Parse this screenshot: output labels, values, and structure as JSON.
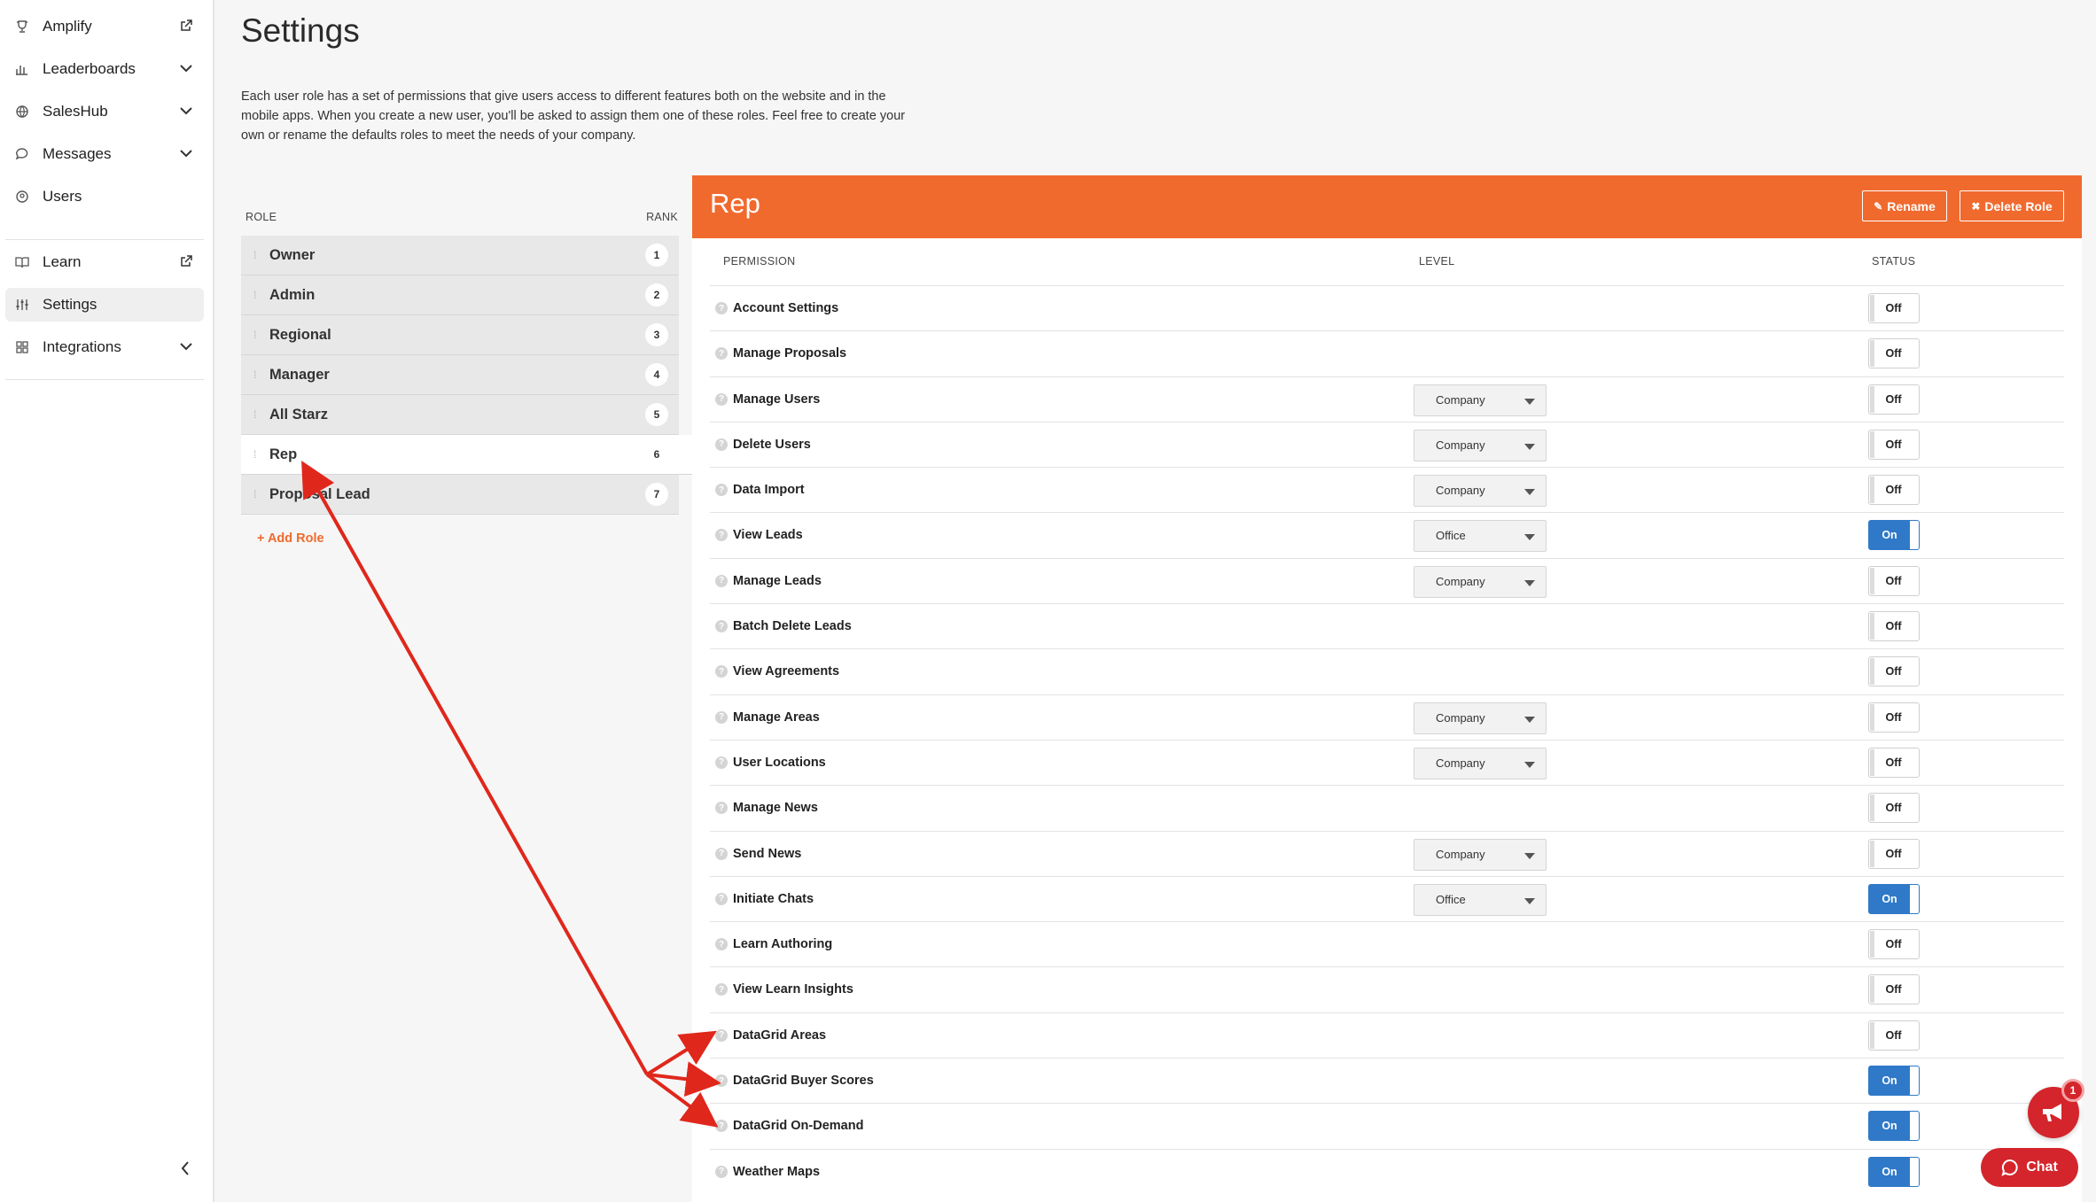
{
  "sidebar": {
    "items": [
      {
        "label": "Amplify",
        "icon": "trophy-icon",
        "trail": "external-link-icon"
      },
      {
        "label": "Leaderboards",
        "icon": "bar-chart-icon",
        "trail": "chevron-down-icon"
      },
      {
        "label": "SalesHub",
        "icon": "globe-icon",
        "trail": "chevron-down-icon"
      },
      {
        "label": "Messages",
        "icon": "chat-bubble-icon",
        "trail": "chevron-down-icon"
      },
      {
        "label": "Users",
        "icon": "user-circle-icon",
        "trail": ""
      },
      {
        "label": "Learn",
        "icon": "book-icon",
        "trail": "external-link-icon"
      },
      {
        "label": "Settings",
        "icon": "sliders-icon",
        "trail": "",
        "active": true
      },
      {
        "label": "Integrations",
        "icon": "grid-icon",
        "trail": "chevron-down-icon"
      }
    ]
  },
  "page": {
    "title": "Settings",
    "intro": "Each user role has a set of permissions that give users access to different features both on the website and in the mobile apps. When you create a new user, you'll be asked to assign them one of these roles. Feel free to create your own or rename the defaults roles to meet the needs of your company."
  },
  "roles": {
    "header_role": "ROLE",
    "header_rank": "RANK",
    "items": [
      {
        "name": "Owner",
        "rank": "1"
      },
      {
        "name": "Admin",
        "rank": "2"
      },
      {
        "name": "Regional",
        "rank": "3"
      },
      {
        "name": "Manager",
        "rank": "4"
      },
      {
        "name": "All Starz",
        "rank": "5"
      },
      {
        "name": "Rep",
        "rank": "6",
        "active": true
      },
      {
        "name": "Proposal Lead",
        "rank": "7"
      }
    ],
    "add_label": "+ Add Role"
  },
  "panel": {
    "title": "Rep",
    "rename_label": "Rename",
    "delete_label": "Delete Role",
    "col_permission": "PERMISSION",
    "col_level": "LEVEL",
    "col_status": "STATUS",
    "accent_color": "#f06a2e",
    "on_color": "#2f79c8",
    "permissions": [
      {
        "name": "Account Settings",
        "level": "",
        "status": "Off"
      },
      {
        "name": "Manage Proposals",
        "level": "",
        "status": "Off"
      },
      {
        "name": "Manage Users",
        "level": "Company",
        "status": "Off"
      },
      {
        "name": "Delete Users",
        "level": "Company",
        "status": "Off"
      },
      {
        "name": "Data Import",
        "level": "Company",
        "status": "Off"
      },
      {
        "name": "View Leads",
        "level": "Office",
        "status": "On"
      },
      {
        "name": "Manage Leads",
        "level": "Company",
        "status": "Off"
      },
      {
        "name": "Batch Delete Leads",
        "level": "",
        "status": "Off"
      },
      {
        "name": "View Agreements",
        "level": "",
        "status": "Off"
      },
      {
        "name": "Manage Areas",
        "level": "Company",
        "status": "Off"
      },
      {
        "name": "User Locations",
        "level": "Company",
        "status": "Off"
      },
      {
        "name": "Manage News",
        "level": "",
        "status": "Off"
      },
      {
        "name": "Send News",
        "level": "Company",
        "status": "Off"
      },
      {
        "name": "Initiate Chats",
        "level": "Office",
        "status": "On"
      },
      {
        "name": "Learn Authoring",
        "level": "",
        "status": "Off"
      },
      {
        "name": "View Learn Insights",
        "level": "",
        "status": "Off"
      },
      {
        "name": "DataGrid Areas",
        "level": "",
        "status": "Off"
      },
      {
        "name": "DataGrid Buyer Scores",
        "level": "",
        "status": "On"
      },
      {
        "name": "DataGrid On-Demand",
        "level": "",
        "status": "On"
      },
      {
        "name": "Weather Maps",
        "level": "",
        "status": "On"
      }
    ]
  },
  "floating": {
    "announce_badge": "1",
    "chat_label": "Chat"
  }
}
